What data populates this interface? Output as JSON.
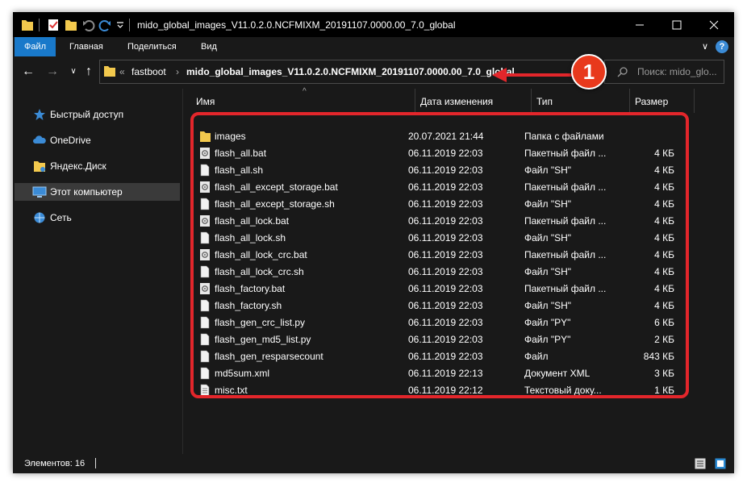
{
  "window": {
    "title": "mido_global_images_V11.0.2.0.NCFMIXM_20191107.0000.00_7.0_global",
    "minimize": "—",
    "maximize": "☐",
    "close": "✕"
  },
  "ribbon": {
    "tabs": [
      "Файл",
      "Главная",
      "Поделиться",
      "Вид"
    ],
    "collapse": "∨",
    "help": "?"
  },
  "nav": {
    "back": "←",
    "forward": "→",
    "recent": "∨",
    "up": "↑",
    "crumb_sep": "«",
    "crumbs": [
      "fastboot",
      "mido_global_images_V11.0.2.0.NCFMIXM_20191107.0000.00_7.0_global"
    ],
    "chevron": "›",
    "dropdown": "∨",
    "refresh": "↻",
    "search_placeholder": "Поиск: mido_glo..."
  },
  "sidebar": {
    "items": [
      {
        "label": "Быстрый доступ",
        "icon": "star-icon"
      },
      {
        "label": "OneDrive",
        "icon": "cloud-icon"
      },
      {
        "label": "Яндекс.Диск",
        "icon": "yandex-disk-icon"
      },
      {
        "label": "Этот компьютер",
        "icon": "computer-icon"
      },
      {
        "label": "Сеть",
        "icon": "network-icon"
      }
    ]
  },
  "columns": {
    "name": "Имя",
    "date": "Дата изменения",
    "type": "Тип",
    "size": "Размер",
    "sort_glyph": "^"
  },
  "files": [
    {
      "name": "images",
      "date": "20.07.2021 21:44",
      "type": "Папка с файлами",
      "size": "",
      "icon": "folder-icon"
    },
    {
      "name": "flash_all.bat",
      "date": "06.11.2019 22:03",
      "type": "Пакетный файл ...",
      "size": "4 КБ",
      "icon": "bat-file-icon"
    },
    {
      "name": "flash_all.sh",
      "date": "06.11.2019 22:03",
      "type": "Файл \"SH\"",
      "size": "4 КБ",
      "icon": "file-icon"
    },
    {
      "name": "flash_all_except_storage.bat",
      "date": "06.11.2019 22:03",
      "type": "Пакетный файл ...",
      "size": "4 КБ",
      "icon": "bat-file-icon"
    },
    {
      "name": "flash_all_except_storage.sh",
      "date": "06.11.2019 22:03",
      "type": "Файл \"SH\"",
      "size": "4 КБ",
      "icon": "file-icon"
    },
    {
      "name": "flash_all_lock.bat",
      "date": "06.11.2019 22:03",
      "type": "Пакетный файл ...",
      "size": "4 КБ",
      "icon": "bat-file-icon"
    },
    {
      "name": "flash_all_lock.sh",
      "date": "06.11.2019 22:03",
      "type": "Файл \"SH\"",
      "size": "4 КБ",
      "icon": "file-icon"
    },
    {
      "name": "flash_all_lock_crc.bat",
      "date": "06.11.2019 22:03",
      "type": "Пакетный файл ...",
      "size": "4 КБ",
      "icon": "bat-file-icon"
    },
    {
      "name": "flash_all_lock_crc.sh",
      "date": "06.11.2019 22:03",
      "type": "Файл \"SH\"",
      "size": "4 КБ",
      "icon": "file-icon"
    },
    {
      "name": "flash_factory.bat",
      "date": "06.11.2019 22:03",
      "type": "Пакетный файл ...",
      "size": "4 КБ",
      "icon": "bat-file-icon"
    },
    {
      "name": "flash_factory.sh",
      "date": "06.11.2019 22:03",
      "type": "Файл \"SH\"",
      "size": "4 КБ",
      "icon": "file-icon"
    },
    {
      "name": "flash_gen_crc_list.py",
      "date": "06.11.2019 22:03",
      "type": "Файл \"PY\"",
      "size": "6 КБ",
      "icon": "file-icon"
    },
    {
      "name": "flash_gen_md5_list.py",
      "date": "06.11.2019 22:03",
      "type": "Файл \"PY\"",
      "size": "2 КБ",
      "icon": "file-icon"
    },
    {
      "name": "flash_gen_resparsecount",
      "date": "06.11.2019 22:03",
      "type": "Файл",
      "size": "843 КБ",
      "icon": "file-icon"
    },
    {
      "name": "md5sum.xml",
      "date": "06.11.2019 22:13",
      "type": "Документ XML",
      "size": "3 КБ",
      "icon": "file-icon"
    },
    {
      "name": "misc.txt",
      "date": "06.11.2019 22:12",
      "type": "Текстовый доку...",
      "size": "1 КБ",
      "icon": "text-file-icon"
    }
  ],
  "status": {
    "count": "Элементов: 16"
  },
  "annotation": {
    "badge": "1"
  },
  "colors": {
    "window_bg": "#191919",
    "accent": "#1979ca",
    "highlight": "#e3262b",
    "badge": "#e8391c",
    "folder": "#f3c94d"
  }
}
